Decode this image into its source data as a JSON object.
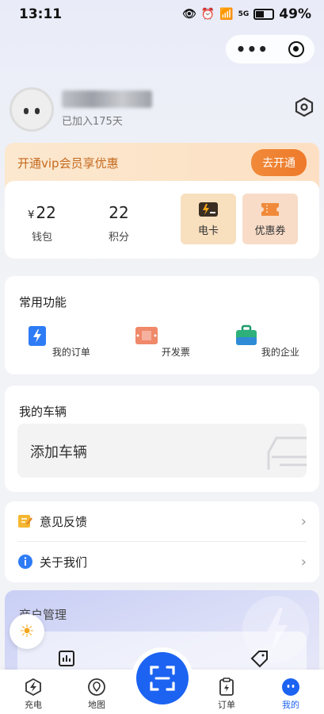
{
  "status_bar": {
    "time": "13:11",
    "battery": "49%",
    "network": "5G"
  },
  "capsule": {
    "more_icon": "more-dots-icon",
    "close_icon": "target-icon"
  },
  "profile": {
    "joined_text": "已加入175天"
  },
  "vip": {
    "banner_text": "开通vip会员享优惠",
    "button_label": "去开通"
  },
  "wallet": {
    "currency": "¥",
    "wallet_value": "22",
    "wallet_label": "钱包",
    "points_value": "22",
    "points_label": "积分",
    "elec_card_label": "电卡",
    "coupon_label": "优惠券"
  },
  "common_functions": {
    "title": "常用功能",
    "items": [
      {
        "label": "我的订单",
        "icon": "order-icon"
      },
      {
        "label": "开发票",
        "icon": "invoice-icon"
      },
      {
        "label": "我的企业",
        "icon": "enterprise-icon"
      }
    ]
  },
  "vehicles": {
    "title": "我的车辆",
    "add_label": "添加车辆"
  },
  "menu": {
    "feedback_label": "意见反馈",
    "about_label": "关于我们"
  },
  "merchant": {
    "title": "商户管理"
  },
  "tabbar": {
    "items": [
      {
        "label": "充电",
        "active": false
      },
      {
        "label": "地图",
        "active": false
      },
      {
        "label": "订单",
        "active": false
      },
      {
        "label": "我的",
        "active": true
      }
    ]
  },
  "colors": {
    "accent": "#1d63f2",
    "vip_orange": "#ee7a2a",
    "vip_text": "#c56a1e"
  }
}
